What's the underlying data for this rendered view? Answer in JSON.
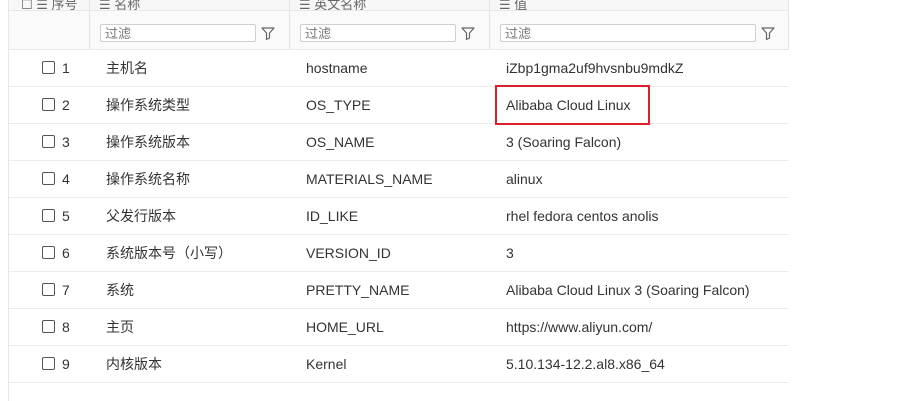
{
  "columns": {
    "index": "序号",
    "name": "名称",
    "english_name": "英文名称",
    "value": "值"
  },
  "filter_placeholder": "过滤",
  "rows": [
    {
      "index": "1",
      "name": "主机名",
      "key": "hostname",
      "value": "iZbp1gma2uf9hvsnbu9mdkZ"
    },
    {
      "index": "2",
      "name": "操作系统类型",
      "key": "OS_TYPE",
      "value": "Alibaba Cloud Linux"
    },
    {
      "index": "3",
      "name": "操作系统版本",
      "key": "OS_NAME",
      "value": "3 (Soaring Falcon)"
    },
    {
      "index": "4",
      "name": "操作系统名称",
      "key": "MATERIALS_NAME",
      "value": "alinux"
    },
    {
      "index": "5",
      "name": "父发行版本",
      "key": "ID_LIKE",
      "value": "rhel fedora centos anolis"
    },
    {
      "index": "6",
      "name": "系统版本号（小写）",
      "key": "VERSION_ID",
      "value": "3"
    },
    {
      "index": "7",
      "name": "系统",
      "key": "PRETTY_NAME",
      "value": "Alibaba Cloud Linux 3 (Soaring Falcon)"
    },
    {
      "index": "8",
      "name": "主页",
      "key": "HOME_URL",
      "value": "https://www.aliyun.com/"
    },
    {
      "index": "9",
      "name": "内核版本",
      "key": "Kernel",
      "value": "5.10.134-12.2.al8.x86_64"
    }
  ],
  "colors": {
    "highlight": "#d9202a"
  }
}
